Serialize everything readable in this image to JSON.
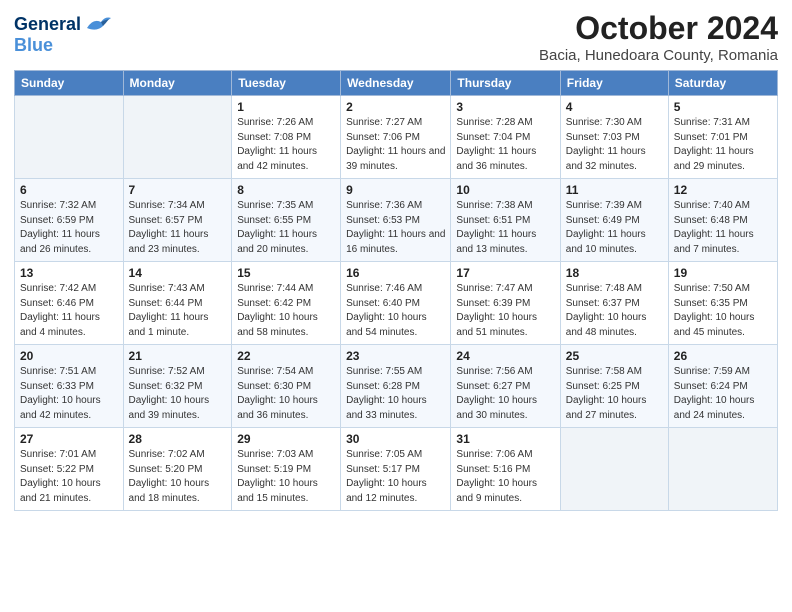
{
  "header": {
    "logo_line1": "General",
    "logo_line2": "Blue",
    "title": "October 2024",
    "subtitle": "Bacia, Hunedoara County, Romania"
  },
  "weekdays": [
    "Sunday",
    "Monday",
    "Tuesday",
    "Wednesday",
    "Thursday",
    "Friday",
    "Saturday"
  ],
  "weeks": [
    [
      {
        "day": "",
        "empty": true
      },
      {
        "day": "",
        "empty": true
      },
      {
        "day": "1",
        "sunrise": "7:26 AM",
        "sunset": "7:08 PM",
        "daylight": "11 hours and 42 minutes."
      },
      {
        "day": "2",
        "sunrise": "7:27 AM",
        "sunset": "7:06 PM",
        "daylight": "11 hours and 39 minutes."
      },
      {
        "day": "3",
        "sunrise": "7:28 AM",
        "sunset": "7:04 PM",
        "daylight": "11 hours and 36 minutes."
      },
      {
        "day": "4",
        "sunrise": "7:30 AM",
        "sunset": "7:03 PM",
        "daylight": "11 hours and 32 minutes."
      },
      {
        "day": "5",
        "sunrise": "7:31 AM",
        "sunset": "7:01 PM",
        "daylight": "11 hours and 29 minutes."
      }
    ],
    [
      {
        "day": "6",
        "sunrise": "7:32 AM",
        "sunset": "6:59 PM",
        "daylight": "11 hours and 26 minutes."
      },
      {
        "day": "7",
        "sunrise": "7:34 AM",
        "sunset": "6:57 PM",
        "daylight": "11 hours and 23 minutes."
      },
      {
        "day": "8",
        "sunrise": "7:35 AM",
        "sunset": "6:55 PM",
        "daylight": "11 hours and 20 minutes."
      },
      {
        "day": "9",
        "sunrise": "7:36 AM",
        "sunset": "6:53 PM",
        "daylight": "11 hours and 16 minutes."
      },
      {
        "day": "10",
        "sunrise": "7:38 AM",
        "sunset": "6:51 PM",
        "daylight": "11 hours and 13 minutes."
      },
      {
        "day": "11",
        "sunrise": "7:39 AM",
        "sunset": "6:49 PM",
        "daylight": "11 hours and 10 minutes."
      },
      {
        "day": "12",
        "sunrise": "7:40 AM",
        "sunset": "6:48 PM",
        "daylight": "11 hours and 7 minutes."
      }
    ],
    [
      {
        "day": "13",
        "sunrise": "7:42 AM",
        "sunset": "6:46 PM",
        "daylight": "11 hours and 4 minutes."
      },
      {
        "day": "14",
        "sunrise": "7:43 AM",
        "sunset": "6:44 PM",
        "daylight": "11 hours and 1 minute."
      },
      {
        "day": "15",
        "sunrise": "7:44 AM",
        "sunset": "6:42 PM",
        "daylight": "10 hours and 58 minutes."
      },
      {
        "day": "16",
        "sunrise": "7:46 AM",
        "sunset": "6:40 PM",
        "daylight": "10 hours and 54 minutes."
      },
      {
        "day": "17",
        "sunrise": "7:47 AM",
        "sunset": "6:39 PM",
        "daylight": "10 hours and 51 minutes."
      },
      {
        "day": "18",
        "sunrise": "7:48 AM",
        "sunset": "6:37 PM",
        "daylight": "10 hours and 48 minutes."
      },
      {
        "day": "19",
        "sunrise": "7:50 AM",
        "sunset": "6:35 PM",
        "daylight": "10 hours and 45 minutes."
      }
    ],
    [
      {
        "day": "20",
        "sunrise": "7:51 AM",
        "sunset": "6:33 PM",
        "daylight": "10 hours and 42 minutes."
      },
      {
        "day": "21",
        "sunrise": "7:52 AM",
        "sunset": "6:32 PM",
        "daylight": "10 hours and 39 minutes."
      },
      {
        "day": "22",
        "sunrise": "7:54 AM",
        "sunset": "6:30 PM",
        "daylight": "10 hours and 36 minutes."
      },
      {
        "day": "23",
        "sunrise": "7:55 AM",
        "sunset": "6:28 PM",
        "daylight": "10 hours and 33 minutes."
      },
      {
        "day": "24",
        "sunrise": "7:56 AM",
        "sunset": "6:27 PM",
        "daylight": "10 hours and 30 minutes."
      },
      {
        "day": "25",
        "sunrise": "7:58 AM",
        "sunset": "6:25 PM",
        "daylight": "10 hours and 27 minutes."
      },
      {
        "day": "26",
        "sunrise": "7:59 AM",
        "sunset": "6:24 PM",
        "daylight": "10 hours and 24 minutes."
      }
    ],
    [
      {
        "day": "27",
        "sunrise": "7:01 AM",
        "sunset": "5:22 PM",
        "daylight": "10 hours and 21 minutes."
      },
      {
        "day": "28",
        "sunrise": "7:02 AM",
        "sunset": "5:20 PM",
        "daylight": "10 hours and 18 minutes."
      },
      {
        "day": "29",
        "sunrise": "7:03 AM",
        "sunset": "5:19 PM",
        "daylight": "10 hours and 15 minutes."
      },
      {
        "day": "30",
        "sunrise": "7:05 AM",
        "sunset": "5:17 PM",
        "daylight": "10 hours and 12 minutes."
      },
      {
        "day": "31",
        "sunrise": "7:06 AM",
        "sunset": "5:16 PM",
        "daylight": "10 hours and 9 minutes."
      },
      {
        "day": "",
        "empty": true
      },
      {
        "day": "",
        "empty": true
      }
    ]
  ]
}
